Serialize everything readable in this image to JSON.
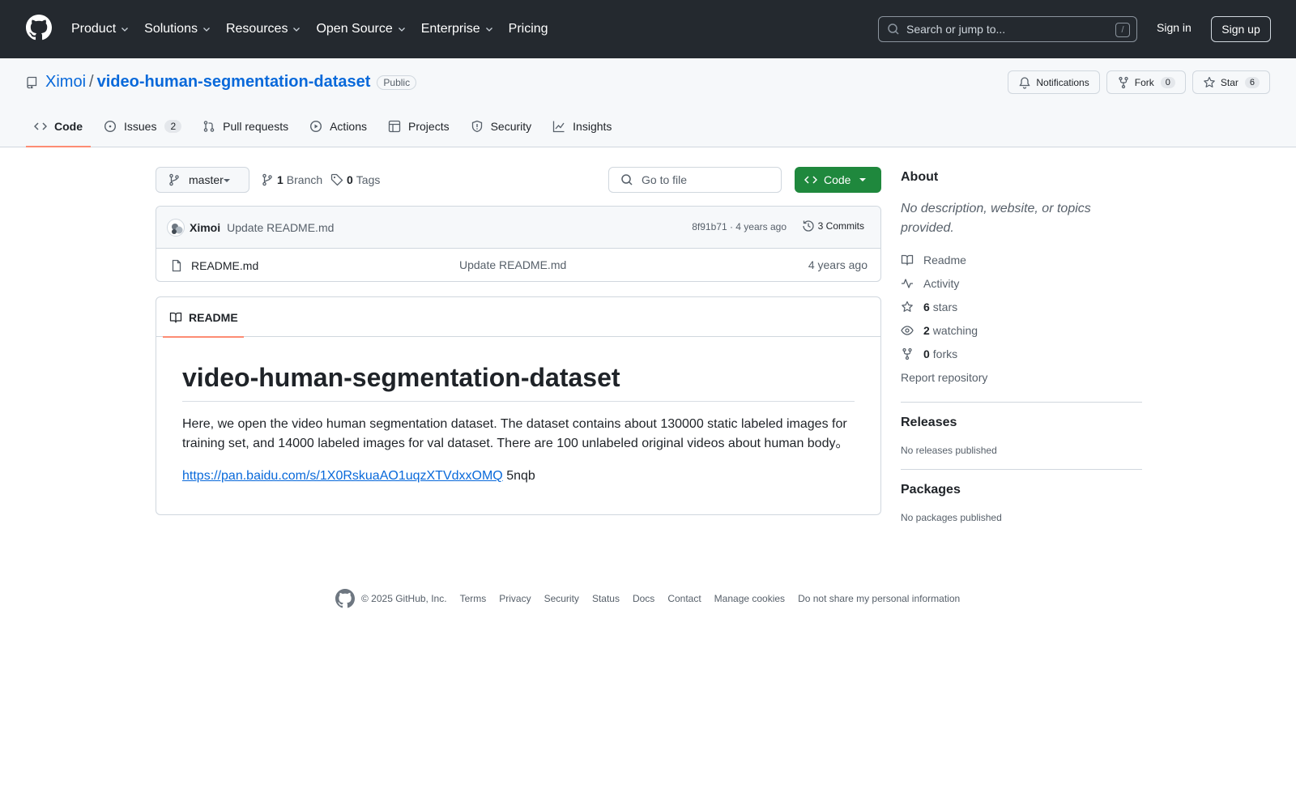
{
  "topnav": {
    "items": [
      "Product",
      "Solutions",
      "Resources",
      "Open Source",
      "Enterprise",
      "Pricing"
    ],
    "search_placeholder": "Search or jump to...",
    "search_shortcut": "/",
    "signin": "Sign in",
    "signup": "Sign up"
  },
  "repo": {
    "owner": "Ximoi",
    "separator": "/",
    "name": "video-human-segmentation-dataset",
    "visibility": "Public",
    "notifications_label": "Notifications",
    "fork_label": "Fork",
    "fork_count": "0",
    "star_label": "Star",
    "star_count": "6"
  },
  "tabs": [
    {
      "label": "Code",
      "icon": "code-icon",
      "active": true
    },
    {
      "label": "Issues",
      "icon": "issue-icon",
      "count": "2"
    },
    {
      "label": "Pull requests",
      "icon": "pull-request-icon"
    },
    {
      "label": "Actions",
      "icon": "play-icon"
    },
    {
      "label": "Projects",
      "icon": "table-icon"
    },
    {
      "label": "Security",
      "icon": "shield-icon"
    },
    {
      "label": "Insights",
      "icon": "graph-icon"
    }
  ],
  "toolbar": {
    "branch": "master",
    "branch_count": "1",
    "branch_label": "Branch",
    "tag_count": "0",
    "tag_label": "Tags",
    "goto_placeholder": "Go to file",
    "code_button": "Code"
  },
  "commit": {
    "author": "Ximoi",
    "message": "Update README.md",
    "meta": "8f91b71 · 4 years ago",
    "commits_label": "3 Commits"
  },
  "files": [
    {
      "name": "README.md",
      "message": "Update README.md",
      "age": "4 years ago"
    }
  ],
  "readme": {
    "tab_label": "README",
    "title": "video-human-segmentation-dataset",
    "paragraph": "Here, we open the video human segmentation dataset. The dataset contains about 130000 static labeled images for training set, and 14000 labeled images for val dataset. There are 100 unlabeled original videos about human body。",
    "link": "https://pan.baidu.com/s/1X0RskuaAO1uqzXTVdxxOMQ",
    "link_suffix": " 5nqb"
  },
  "sidebar": {
    "about_heading": "About",
    "about_desc": "No description, website, or topics provided.",
    "readme": "Readme",
    "activity": "Activity",
    "stars_count": "6",
    "stars_label": "stars",
    "watching_count": "2",
    "watching_label": "watching",
    "forks_count": "0",
    "forks_label": "forks",
    "report": "Report repository",
    "releases_heading": "Releases",
    "releases_text": "No releases published",
    "packages_heading": "Packages",
    "packages_text": "No packages published"
  },
  "footer": {
    "copyright": "© 2025 GitHub, Inc.",
    "links": [
      "Terms",
      "Privacy",
      "Security",
      "Status",
      "Docs",
      "Contact",
      "Manage cookies",
      "Do not share my personal information"
    ]
  },
  "colors": {
    "header_bg": "#24292f",
    "link": "#0969da",
    "primary_button": "#1f883d",
    "active_tab_underline": "#fd8c73"
  }
}
